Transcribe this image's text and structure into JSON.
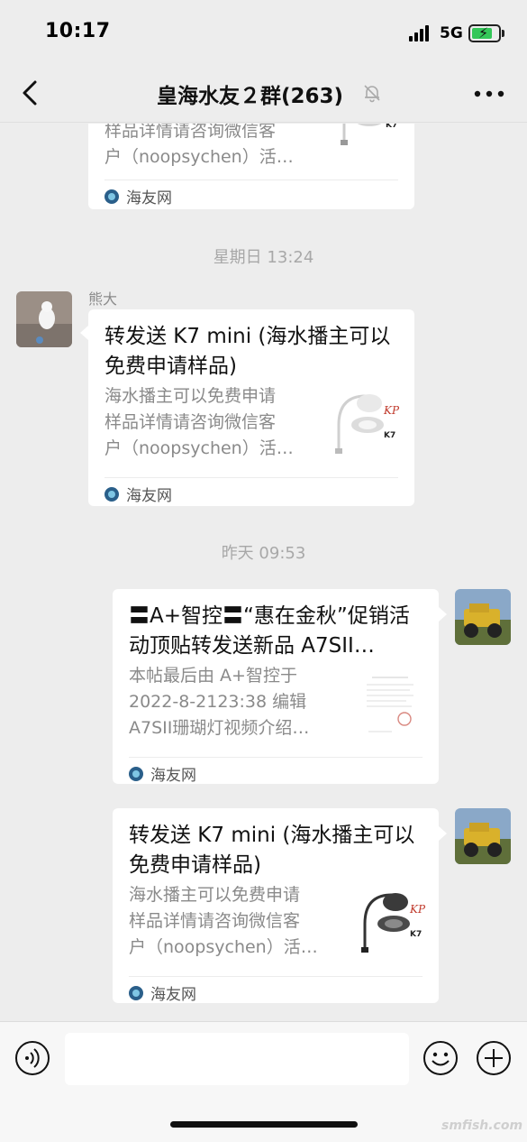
{
  "status_bar": {
    "time": "10:17",
    "network": "5G",
    "battery_percent": 80
  },
  "nav": {
    "title": "皇海水友２群(263)"
  },
  "messages": {
    "card0": {
      "desc_lines": [
        "样品详情请咨询微信客",
        "户（noopsychen）活…"
      ],
      "source": "海友网"
    },
    "timestamp1": "星期日 13:24",
    "card1": {
      "sender": "熊大",
      "title": "转发送 K7 mini (海水播主可以免费申请样品)",
      "desc_lines": [
        "海水播主可以免费申请",
        "样品详情请咨询微信客",
        "户（noopsychen）活…"
      ],
      "source": "海友网"
    },
    "timestamp2": "昨天 09:53",
    "card2": {
      "title": "〓A+智控〓“惠在金秋”促销活动顶贴转发送新品 A7SII…",
      "desc_lines": [
        "本帖最后由 A+智控于",
        "2022-8-2123:38 编辑",
        "A7SII珊瑚灯视频介绍…"
      ],
      "source": "海友网"
    },
    "card3": {
      "title": "转发送 K7 mini (海水播主可以免费申请样品)",
      "desc_lines": [
        "海水播主可以免费申请",
        "样品详情请咨询微信客",
        "户（noopsychen）活…"
      ],
      "source": "海友网"
    }
  },
  "thumb_text": {
    "brand": "KP",
    "model": "K7"
  },
  "watermark": "smfish.com",
  "icons": [
    "back-icon",
    "mute-bell-icon",
    "more-icon",
    "voice-icon",
    "emoji-icon",
    "plus-icon"
  ]
}
